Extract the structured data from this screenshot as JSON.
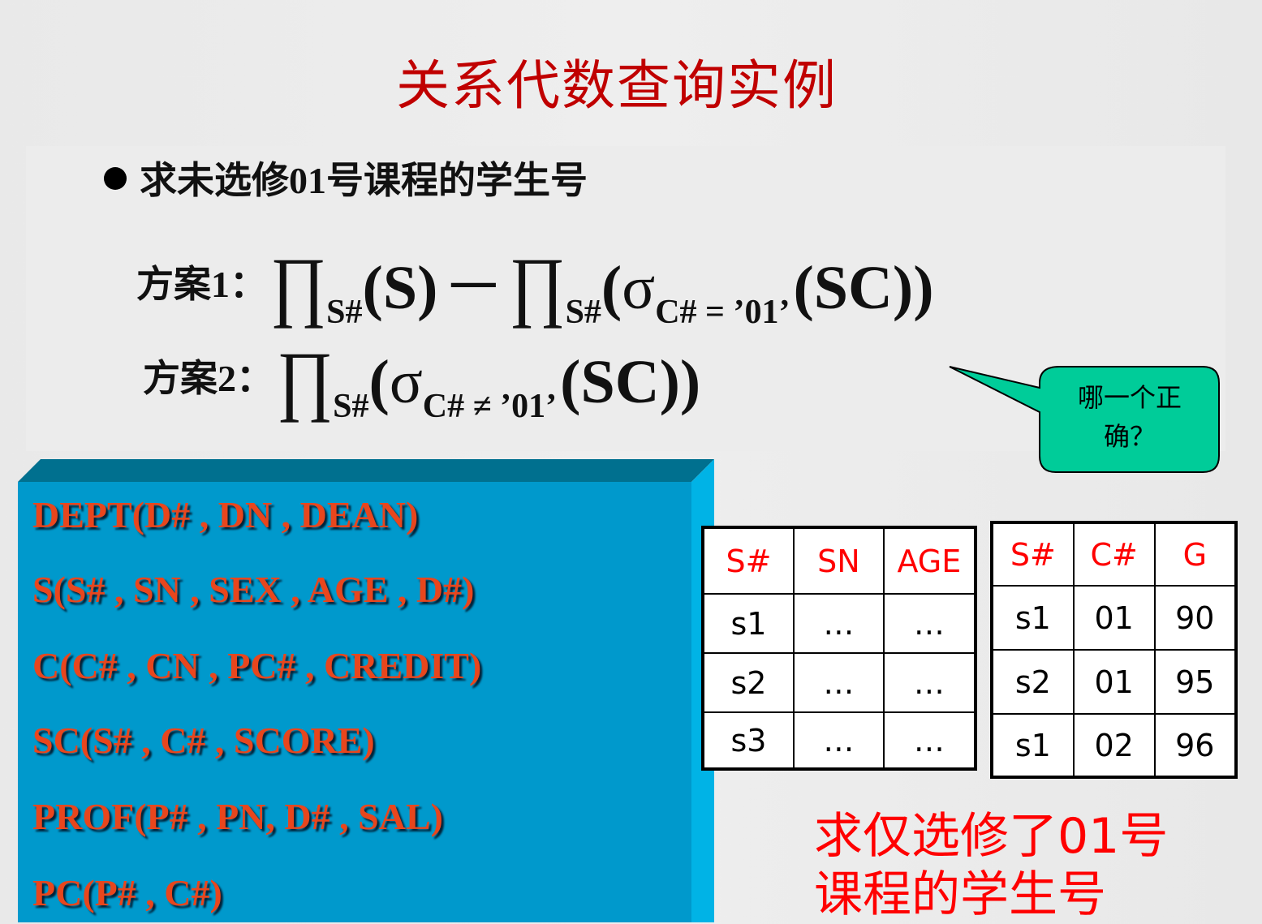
{
  "title": "关系代数查询实例",
  "bullet": "求未选修01号课程的学生号",
  "plan1": {
    "label": "方案1：",
    "pi": "∏",
    "sub_s": "S#",
    "open_s": "(S)",
    "minus": "－",
    "sigma": "σ",
    "cond": "C# = ’01’",
    "tail": "(SC))"
  },
  "plan2": {
    "label": "方案2：",
    "pi": "∏",
    "sub_s": "S#",
    "sigma": "σ",
    "cond": "C# ≠ ’01’",
    "tail": "(SC))"
  },
  "callout": {
    "line1": "哪一个正",
    "line2": "确？",
    "fill_color": "#00cc99"
  },
  "schemas": [
    "DEPT(D# , DN , DEAN)",
    "S(S# , SN , SEX , AGE , D#)",
    "C(C# , CN , PC# , CREDIT)",
    "SC(S# , C# , SCORE)",
    "PROF(P# , PN, D# , SAL)",
    "PC(P# , C#)"
  ],
  "table_s": {
    "headers": [
      "S#",
      "SN",
      "AGE"
    ],
    "rows": [
      [
        "s1",
        "…",
        "…"
      ],
      [
        "s2",
        "…",
        "…"
      ],
      [
        "s3",
        "…",
        "…"
      ]
    ]
  },
  "table_sc": {
    "headers": [
      "S#",
      "C#",
      "G"
    ],
    "rows": [
      [
        "s1",
        "01",
        "90"
      ],
      [
        "s2",
        "01",
        "95"
      ],
      [
        "s1",
        "02",
        "96"
      ]
    ]
  },
  "question": {
    "line1": "求仅选修了01号",
    "line2": "课程的学生号"
  },
  "colors": {
    "title": "#c00000",
    "schema_text": "#e8461d",
    "box_front": "#0099cc",
    "box_top": "#00708f",
    "box_side": "#00b3e6",
    "question": "#ff0000"
  }
}
